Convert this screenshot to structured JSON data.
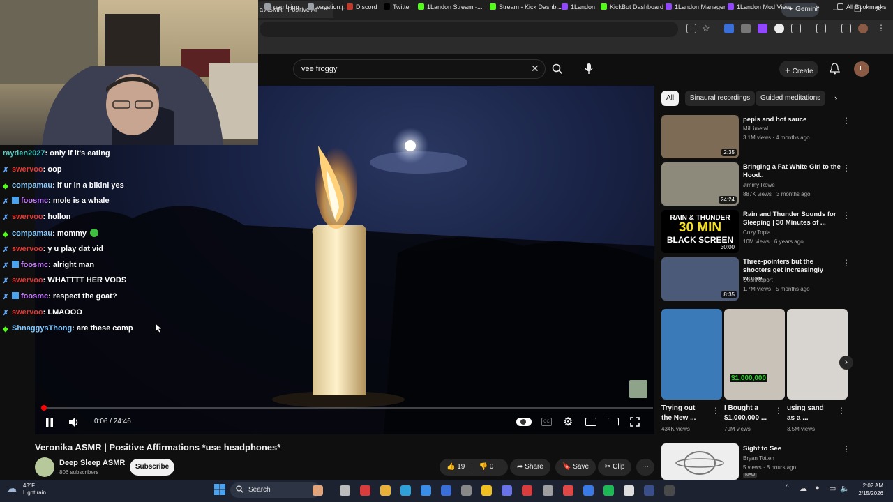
{
  "browser": {
    "tab_title": "a ASMR | Positive Af",
    "gemini_label": "Gemini",
    "bookmarks": [
      {
        "label": "gambling",
        "color": "#9aa0a6"
      },
      {
        "label": "vacation",
        "color": "#9aa0a6"
      },
      {
        "label": "Discord",
        "color": "#c0392b"
      },
      {
        "label": "Twitter",
        "color": "#000000"
      },
      {
        "label": "1Landon Stream -...",
        "color": "#53fc18"
      },
      {
        "label": "Stream - Kick Dashb...",
        "color": "#53fc18"
      },
      {
        "label": "1Landon",
        "color": "#9146ff"
      },
      {
        "label": "KickBot Dashboard",
        "color": "#53fc18"
      },
      {
        "label": "1Landon Manager",
        "color": "#9146ff"
      },
      {
        "label": "1Landon Mod View",
        "color": "#9146ff"
      }
    ],
    "all_bookmarks": "All Bookmarks"
  },
  "youtube": {
    "search_value": "vee froggy",
    "create_label": "Create",
    "avatar_letter": "L"
  },
  "chat": [
    {
      "user": "rayden2027",
      "msg": "only if it's eating",
      "color": "#4ecdc4",
      "badges": []
    },
    {
      "user": "swervoo",
      "msg": "oop",
      "color": "#e53935",
      "badges": [
        "sword"
      ]
    },
    {
      "user": "compamau",
      "msg": "if ur in a bikini yes",
      "color": "#8fd0ff",
      "badges": [
        "diamond"
      ]
    },
    {
      "user": "foosmc",
      "msg": "mole is a whale",
      "color": "#c77dff",
      "badges": [
        "sword",
        "grid"
      ]
    },
    {
      "user": "swervoo",
      "msg": "hollon",
      "color": "#e53935",
      "badges": [
        "sword"
      ]
    },
    {
      "user": "compamau",
      "msg": "mommy",
      "color": "#8fd0ff",
      "badges": [
        "diamond"
      ],
      "emote": true
    },
    {
      "user": "swervoo",
      "msg": "y u play dat vid",
      "color": "#e53935",
      "badges": [
        "sword"
      ]
    },
    {
      "user": "foosmc",
      "msg": "alright man",
      "color": "#c77dff",
      "badges": [
        "sword",
        "grid"
      ]
    },
    {
      "user": "swervoo",
      "msg": "WHATTTT HER VODS",
      "color": "#e53935",
      "badges": [
        "sword"
      ]
    },
    {
      "user": "foosmc",
      "msg": "respect the goat?",
      "color": "#c77dff",
      "badges": [
        "sword",
        "grid"
      ]
    },
    {
      "user": "swervoo",
      "msg": "LMAOOO",
      "color": "#e53935",
      "badges": [
        "sword"
      ]
    },
    {
      "user": "ShnaggysThong",
      "msg": "are these comp",
      "color": "#7fc8ff",
      "badges": [
        "diamond"
      ]
    }
  ],
  "player": {
    "timecode": "0:06 / 24:46",
    "progress": 0.004
  },
  "video": {
    "title": "Veronika ASMR | Positive Affirmations *use headphones*",
    "channel": "Deep Sleep ASMR",
    "subscribers": "806 subscribers",
    "subscribe_label": "Subscribe",
    "likes": "19",
    "dislikes": "0",
    "share_label": "Share",
    "save_label": "Save",
    "clip_label": "Clip"
  },
  "chips": [
    "All",
    "Binaural recordings",
    "Guided meditations"
  ],
  "recommendations": [
    {
      "title": "pepis and hot sauce",
      "channel": "MilLimetal",
      "meta": "3.1M views · 4 months ago",
      "duration": "2:35",
      "thumb": "#7d6b56"
    },
    {
      "title": "Bringing a Fat White Girl to the Hood..",
      "channel": "Jimmy Rowe",
      "meta": "887K views · 3 months ago",
      "duration": "24:24",
      "thumb": "#8d8a7c"
    },
    {
      "title": "Rain and Thunder Sounds for Sleeping | 30 Minutes of ...",
      "channel": "Cozy Topia",
      "meta": "10M views · 6 years ago",
      "duration": "30:00",
      "thumb": "#000000",
      "thumb_text_1": "RAIN & THUNDER",
      "thumb_text_2": "30 MIN",
      "thumb_text_3": "BLACK SCREEN"
    },
    {
      "title": "Three-pointers but the shooters get increasingly worse",
      "channel": "CoshReport",
      "meta": "1.7M views · 5 months ago",
      "duration": "8:35",
      "thumb": "#4a5a78"
    }
  ],
  "shorts": [
    {
      "title": "Trying out the New ...",
      "views": "434K views",
      "thumb": "#3a7ab8"
    },
    {
      "title": "I Bought a $1,000,000 ...",
      "views": "79M views",
      "thumb": "#c8c2b8",
      "overlay": "$1,000,000"
    },
    {
      "title": "using sand as a ...",
      "views": "3.5M views",
      "thumb": "#d8d4cf"
    }
  ],
  "last_rec": {
    "title": "Sight to See",
    "channel": "Bryan Totten",
    "meta": "5 views · 8 hours ago",
    "badge": "New"
  },
  "taskbar": {
    "temp": "43°F",
    "weather": "Light rain",
    "search_label": "Search",
    "time": "2:02 AM",
    "date": "2/15/2026"
  }
}
